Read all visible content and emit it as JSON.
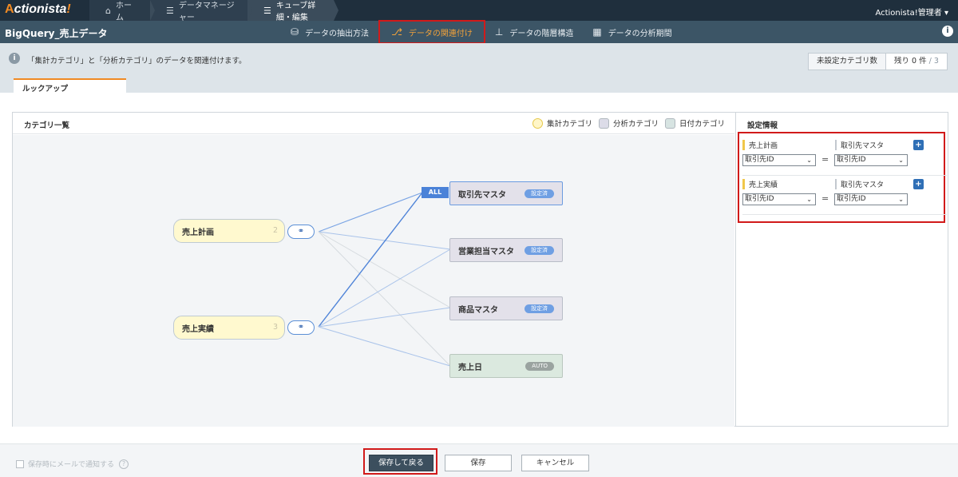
{
  "topbar": {
    "logo_a": "A",
    "logo_rest": "ctionista",
    "logo_bang": "!",
    "crumbs": [
      {
        "icon": "home-icon",
        "label": "ホーム"
      },
      {
        "icon": "list-icon",
        "label": "データマネージャー"
      },
      {
        "icon": "list-icon",
        "label": "キューブ詳細・編集"
      }
    ],
    "user": "Actionista!管理者 ▾"
  },
  "navbar": {
    "title": "BigQuery_売上データ",
    "steps": [
      {
        "icon": "database-icon",
        "label": "データの抽出方法",
        "active": false
      },
      {
        "icon": "link-tree-icon",
        "label": "データの関連付け",
        "active": true
      },
      {
        "icon": "hierarchy-icon",
        "label": "データの階層構造",
        "active": false
      },
      {
        "icon": "calendar-icon",
        "label": "データの分析期間",
        "active": false
      }
    ],
    "info_icon": "info-icon"
  },
  "inforow": {
    "message": "「集計カテゴリ」と「分析カテゴリ」のデータを関連付けます。",
    "counter_label": "未設定カテゴリ数",
    "counter_value": "残り 0 件",
    "counter_total": " / 3",
    "tab": "ルックアップ"
  },
  "category_panel": {
    "title": "カテゴリ一覧",
    "legend": [
      "集計カテゴリ",
      "分析カテゴリ",
      "日付カテゴリ"
    ],
    "aggregate_nodes": [
      {
        "name": "売上計画",
        "count": "2"
      },
      {
        "name": "売上実績",
        "count": "3"
      }
    ],
    "analysis_nodes": [
      {
        "name": "取引先マスタ",
        "badge": "設定済",
        "tag": "ALL"
      },
      {
        "name": "営業担当マスタ",
        "badge": "設定済"
      },
      {
        "name": "商品マスタ",
        "badge": "設定済"
      }
    ],
    "date_nodes": [
      {
        "name": "売上日",
        "badge": "AUTO"
      }
    ],
    "colors": {
      "aggregate": "#fff9cf",
      "analysis": "#e3e1ea",
      "date": "#dbe9df",
      "link": "#5b8fd6"
    }
  },
  "settings_panel": {
    "title": "設定情報",
    "rules": [
      {
        "left_name": "売上計画",
        "right_name": "取引先マスタ",
        "left_key": "取引先ID",
        "right_key": "取引先ID",
        "eq": "="
      },
      {
        "left_name": "売上実績",
        "right_name": "取引先マスタ",
        "left_key": "取引先ID",
        "right_key": "取引先ID",
        "eq": "="
      }
    ]
  },
  "footer": {
    "notify_label": "保存時にメールで通知する",
    "help": "?",
    "save_return": "保存して戻る",
    "save": "保存",
    "cancel": "キャンセル"
  }
}
